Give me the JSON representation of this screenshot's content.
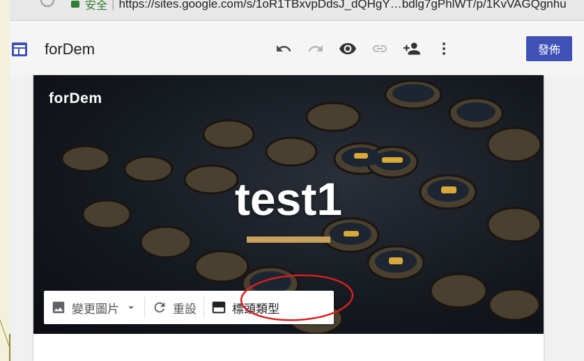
{
  "browser": {
    "secure_label": "安全",
    "separator": "|",
    "url": "https://sites.google.com/s/1oR1TBxvpDdsJ_dQHgY…bdlg7gPhlWT/p/1KvVAGQgnhu"
  },
  "header": {
    "site_name": "forDem",
    "publish_label": "發佈"
  },
  "banner": {
    "site_name": "forDem",
    "title": "test1",
    "underline_color": "#c8a25a"
  },
  "header_toolbar": {
    "change_image_label": "變更圖片",
    "reset_label": "重設",
    "header_type_label": "標頭類型"
  },
  "colors": {
    "publish_button": "#3f51b5",
    "annotation_circle": "#d32020"
  }
}
